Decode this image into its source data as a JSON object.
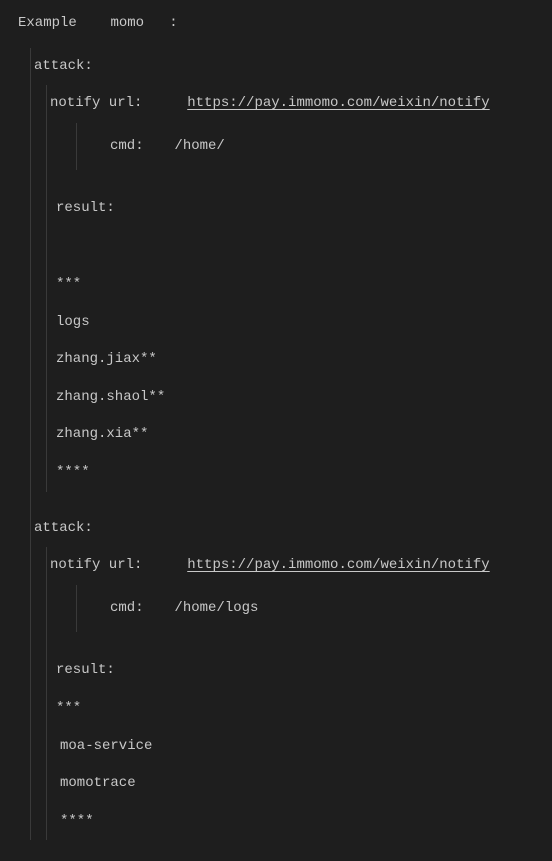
{
  "title_prefix": "Example",
  "title_name": "momo",
  "title_suffix": ":",
  "attacks": [
    {
      "attack_label": "attack:",
      "notify_label": "notify url:",
      "notify_url": "https://pay.immomo.com/weixin/notify",
      "cmd_label": "cmd:",
      "cmd_value": "/home/",
      "result_label": "result:",
      "lines": [
        "***",
        "logs",
        "zhang.jiax**",
        "zhang.shaol**",
        "zhang.xia**",
        "****"
      ]
    },
    {
      "attack_label": "attack:",
      "notify_label": "notify url:",
      "notify_url": "https://pay.immomo.com/weixin/notify",
      "cmd_label": "cmd:",
      "cmd_value": "/home/logs",
      "result_label": "result:",
      "lines": [
        "***",
        " moa-service",
        " momotrace",
        " ****"
      ]
    }
  ]
}
